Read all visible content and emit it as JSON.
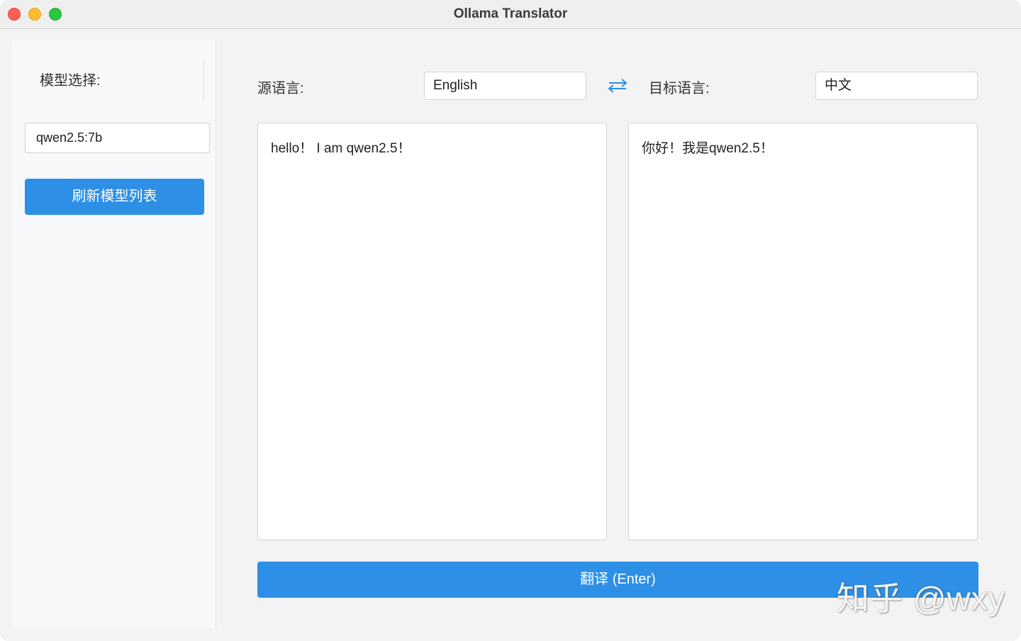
{
  "window": {
    "title": "Ollama Translator"
  },
  "sidebar": {
    "model_label": "模型选择:",
    "model_value": "qwen2.5:7b",
    "refresh_label": "刷新模型列表"
  },
  "main": {
    "source_label": "源语言:",
    "source_value": "English",
    "target_label": "目标语言:",
    "target_value": "中文",
    "source_text": "hello！ I am qwen2.5！",
    "target_text": "你好！我是qwen2.5！",
    "translate_label": "翻译 (Enter)"
  },
  "watermark": {
    "text": "知乎 @wxy"
  },
  "colors": {
    "accent": "#2d8fe6",
    "swap_icon": "#2d8fe6"
  }
}
